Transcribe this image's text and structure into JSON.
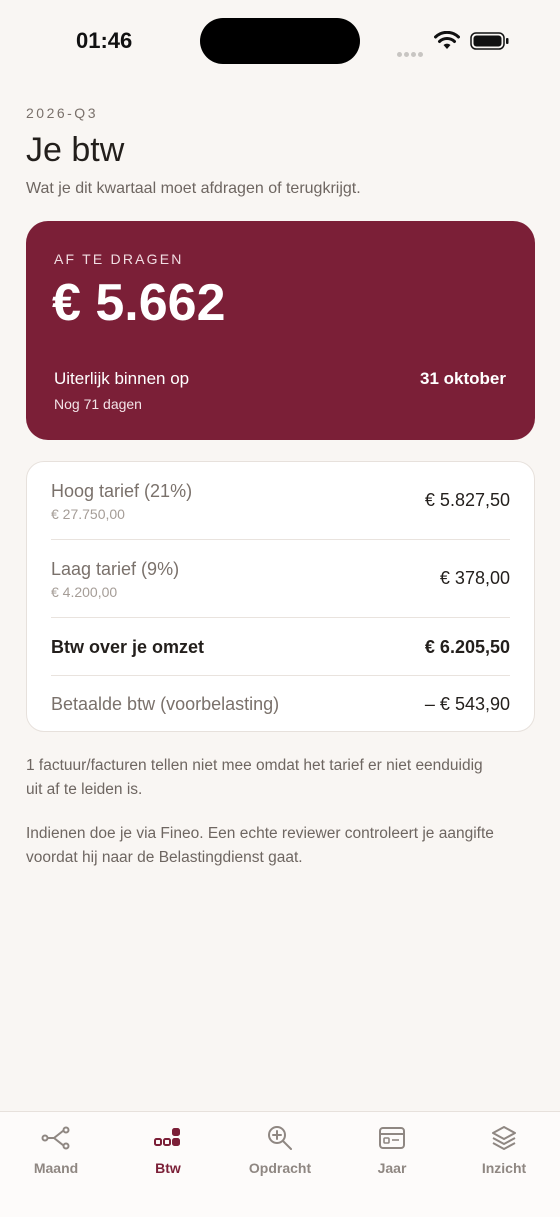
{
  "status_bar": {
    "time": "01:46"
  },
  "header": {
    "period": "2026-Q3",
    "title": "Je btw",
    "subtitle": "Wat je dit kwartaal moet afdragen of terugkrijgt."
  },
  "due": {
    "label": "AF TE DRAGEN",
    "amount": "€ 5.662",
    "deadline_label": "Uiterlijk binnen op",
    "deadline_date": "31 oktober",
    "days_left": "Nog 71 dagen"
  },
  "breakdown": {
    "rows": [
      {
        "label": "Hoog tarief (21%)",
        "sub": "€ 27.750,00",
        "value": "€ 5.827,50"
      },
      {
        "label": "Laag tarief (9%)",
        "sub": "€ 4.200,00",
        "value": "€ 378,00"
      },
      {
        "label": "Btw over je omzet",
        "value": "€ 6.205,50"
      },
      {
        "label": "Betaalde btw (voorbelasting)",
        "value": "– € 543,90"
      }
    ]
  },
  "notes": {
    "excluded": "1 factuur/facturen tellen niet mee omdat het tarief er niet eenduidig uit af te leiden is.",
    "filing": "Indienen doe je via Fineo. Een echte reviewer controleert je aangifte voordat hij naar de Belastingdienst gaat."
  },
  "tabs": [
    {
      "label": "Maand",
      "icon": "branch-icon",
      "active": false
    },
    {
      "label": "Btw",
      "icon": "btw-blocks-icon",
      "active": true
    },
    {
      "label": "Opdracht",
      "icon": "zoom-in-icon",
      "active": false
    },
    {
      "label": "Jaar",
      "icon": "card-icon",
      "active": false
    },
    {
      "label": "Inzicht",
      "icon": "layers-icon",
      "active": false
    }
  ],
  "colors": {
    "accent": "#7b1f37",
    "background": "#f9f6f3",
    "tab_inactive": "#8f8782"
  }
}
